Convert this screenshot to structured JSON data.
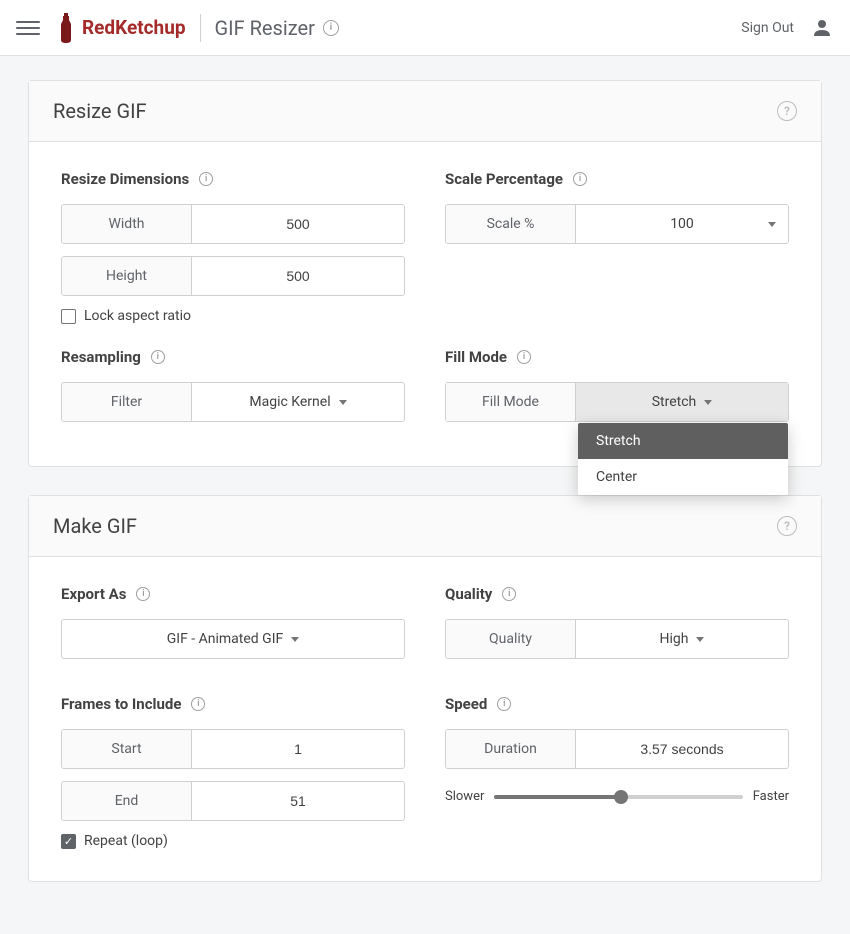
{
  "header": {
    "brand": "RedKetchup",
    "page_title": "GIF Resizer",
    "sign_out": "Sign Out"
  },
  "resize_card": {
    "title": "Resize GIF",
    "dimensions": {
      "label": "Resize Dimensions",
      "width_label": "Width",
      "width_value": "500",
      "height_label": "Height",
      "height_value": "500",
      "lock_label": "Lock aspect ratio"
    },
    "scale": {
      "label": "Scale Percentage",
      "field_label": "Scale %",
      "value": "100"
    },
    "resampling": {
      "label": "Resampling",
      "field_label": "Filter",
      "value": "Magic Kernel"
    },
    "fill_mode": {
      "label": "Fill Mode",
      "field_label": "Fill Mode",
      "value": "Stretch",
      "options": [
        "Stretch",
        "Center"
      ]
    }
  },
  "make_card": {
    "title": "Make GIF",
    "export": {
      "label": "Export As",
      "value": "GIF - Animated GIF"
    },
    "quality": {
      "label": "Quality",
      "field_label": "Quality",
      "value": "High"
    },
    "frames": {
      "label": "Frames to Include",
      "start_label": "Start",
      "start_value": "1",
      "end_label": "End",
      "end_value": "51",
      "repeat_label": "Repeat (loop)"
    },
    "speed": {
      "label": "Speed",
      "duration_label": "Duration",
      "duration_value": "3.57 seconds",
      "slower": "Slower",
      "faster": "Faster"
    }
  }
}
